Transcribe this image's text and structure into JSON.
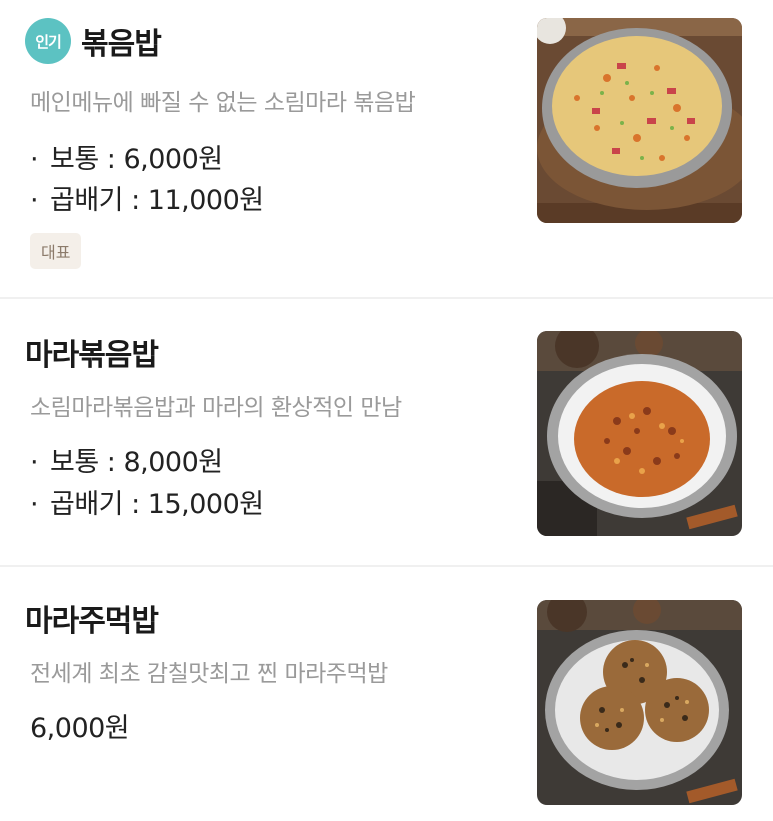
{
  "items": [
    {
      "badge": "인기",
      "name": "볶음밥",
      "description": "메인메뉴에 빠질 수 없는 소림마라 볶음밥",
      "prices": [
        {
          "label": "보통",
          "sep": " : ",
          "price": "6,000원"
        },
        {
          "label": "곱배기",
          "sep": " : ",
          "price": "11,000원"
        }
      ],
      "tag": "대표",
      "image_icon": "fried-rice-image"
    },
    {
      "name": "마라볶음밥",
      "description": "소림마라볶음밥과 마라의 환상적인 만남",
      "prices": [
        {
          "label": "보통",
          "sep": " : ",
          "price": "8,000원"
        },
        {
          "label": "곱배기",
          "sep": " : ",
          "price": "15,000원"
        }
      ],
      "image_icon": "mala-fried-rice-image"
    },
    {
      "name": "마라주먹밥",
      "description": "전세계 최초 감칠맛최고 찐 마라주먹밥",
      "price": "6,000원",
      "image_icon": "mala-rice-ball-image"
    }
  ],
  "colors": {
    "badge": "#5cc2c2",
    "tag_bg": "#f4efe9",
    "tag_text": "#8c7b6b",
    "desc_text": "#9a9a9a",
    "divider": "#f0f0f0"
  }
}
